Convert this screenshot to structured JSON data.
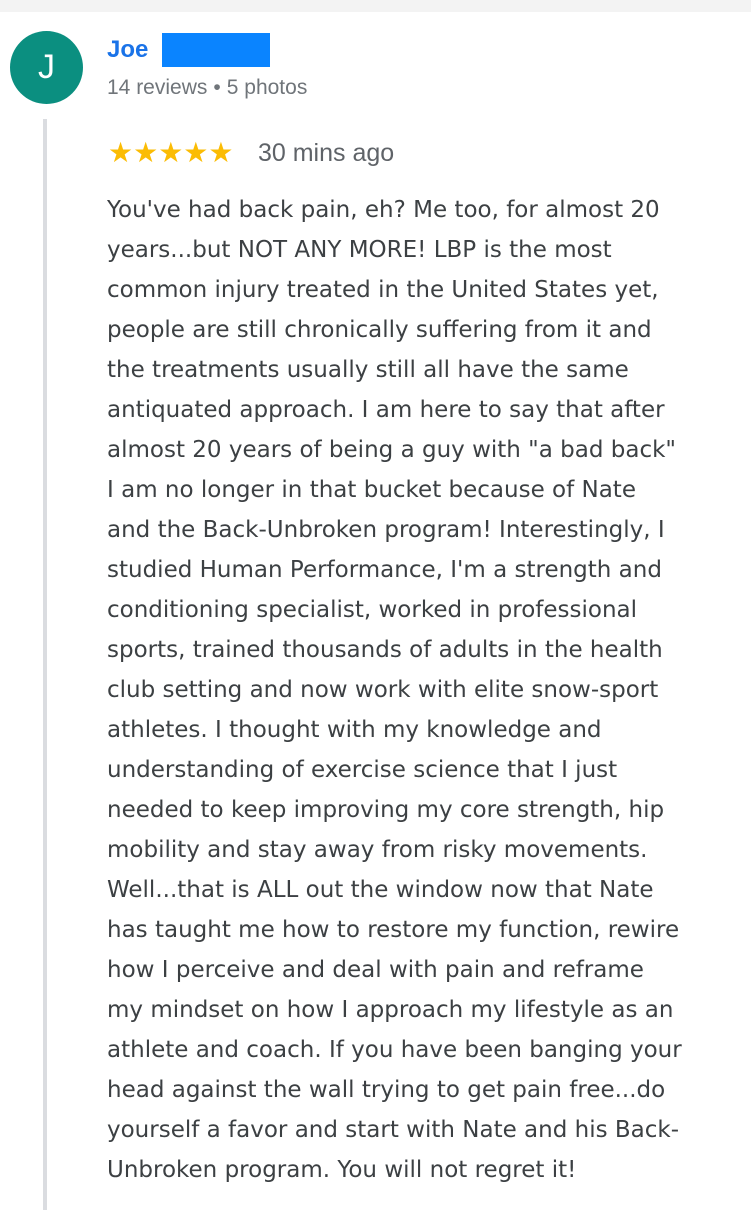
{
  "reviewer": {
    "initial": "J",
    "name": "Joe",
    "reviews": "14 reviews",
    "separator": "•",
    "photos": "5 photos",
    "avatar_color": "#0b8f80",
    "name_color": "#1a73e8"
  },
  "review": {
    "rating": 5,
    "stars": "★★★★★",
    "star_color": "#fbbc04",
    "time": "30 mins ago",
    "text": "You've had back pain, eh? Me too, for almost 20\nyears...but NOT ANY MORE! LBP is the most\ncommon injury treated in the United States yet,\npeople are still chronically suffering from it and\nthe treatments usually still all have the same\nantiquated approach. I am here to say that after\nalmost 20 years of being a guy with \"a bad back\"\nI am no longer in that bucket because of Nate\nand the Back-Unbroken program! Interestingly, I\nstudied Human Performance, I'm a strength and\nconditioning specialist, worked in professional\nsports, trained thousands of adults in the health\nclub setting and now work with elite snow-sport\nathletes. I thought with my knowledge and\nunderstanding of exercise science that I just\nneeded to keep improving my core strength, hip\nmobility and stay away from risky movements.\nWell...that is ALL out the window now that Nate\nhas taught me how to restore my function, rewire\nhow I perceive and deal with pain and reframe\nmy mindset on how I approach my lifestyle as an\nathlete and coach. If you have been banging your\nhead against the wall trying to get pain free...do\nyourself a favor and start with Nate and his Back-\nUnbroken program. You will not regret it!"
  }
}
